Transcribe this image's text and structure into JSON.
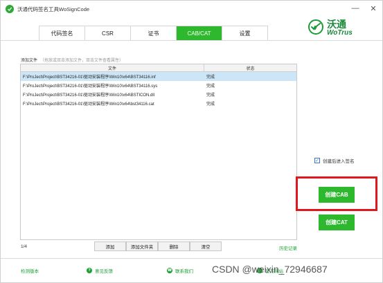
{
  "window": {
    "title": "沃通代码签名工具WoSignCode",
    "controls": {
      "minimize": "—",
      "close": "✕"
    }
  },
  "tabs": [
    {
      "label": "代码签名",
      "active": false
    },
    {
      "label": "CSR",
      "active": false
    },
    {
      "label": "证书",
      "active": false
    },
    {
      "label": "CAB/CAT",
      "active": true
    },
    {
      "label": "设置",
      "active": false
    }
  ],
  "brand": {
    "name_cn": "沃通",
    "name_en": "WoTrus",
    "accent": "#1a8a3a"
  },
  "files_section": {
    "label": "添加文件",
    "hint": "（拖放或双击添加文件，双击文件查看属性）",
    "columns": [
      "文件",
      "状态"
    ],
    "rows": [
      {
        "file": "F:\\ProJect\\Project\\BST34216-01\\驱动安装程序\\Win10\\x64\\BST34116.inf",
        "status": "完成",
        "selected": true
      },
      {
        "file": "F:\\ProJect\\Project\\BST34216-01\\驱动安装程序\\Win10\\x64\\BST34116.sys",
        "status": "完成",
        "selected": false
      },
      {
        "file": "F:\\ProJect\\Project\\BST34216-01\\驱动安装程序\\Win10\\x64\\BSTICON.dll",
        "status": "完成",
        "selected": false
      },
      {
        "file": "F:\\ProJect\\Project\\BST34216-01\\驱动安装程序\\Win10\\x64\\bst34116.cat",
        "status": "完成",
        "selected": false
      }
    ],
    "count": "1/4",
    "buttons": {
      "add": "添加",
      "add_folder": "添加文件夹",
      "delete": "删除",
      "clear": "清空"
    },
    "history": "历史记录"
  },
  "options": {
    "sign_after_create": {
      "label": "创建后进入签名",
      "checked": true
    }
  },
  "actions": {
    "create_cab": "创建CAB",
    "create_cat": "创建CAT",
    "primary_color": "#2eb82e",
    "highlight_color": "#e3151d"
  },
  "footer": {
    "check_version": "检测版本",
    "feedback": "意见反馈",
    "contact": "联系我们",
    "website": "官方网站"
  },
  "watermark": "CSDN @weixin_72946687"
}
